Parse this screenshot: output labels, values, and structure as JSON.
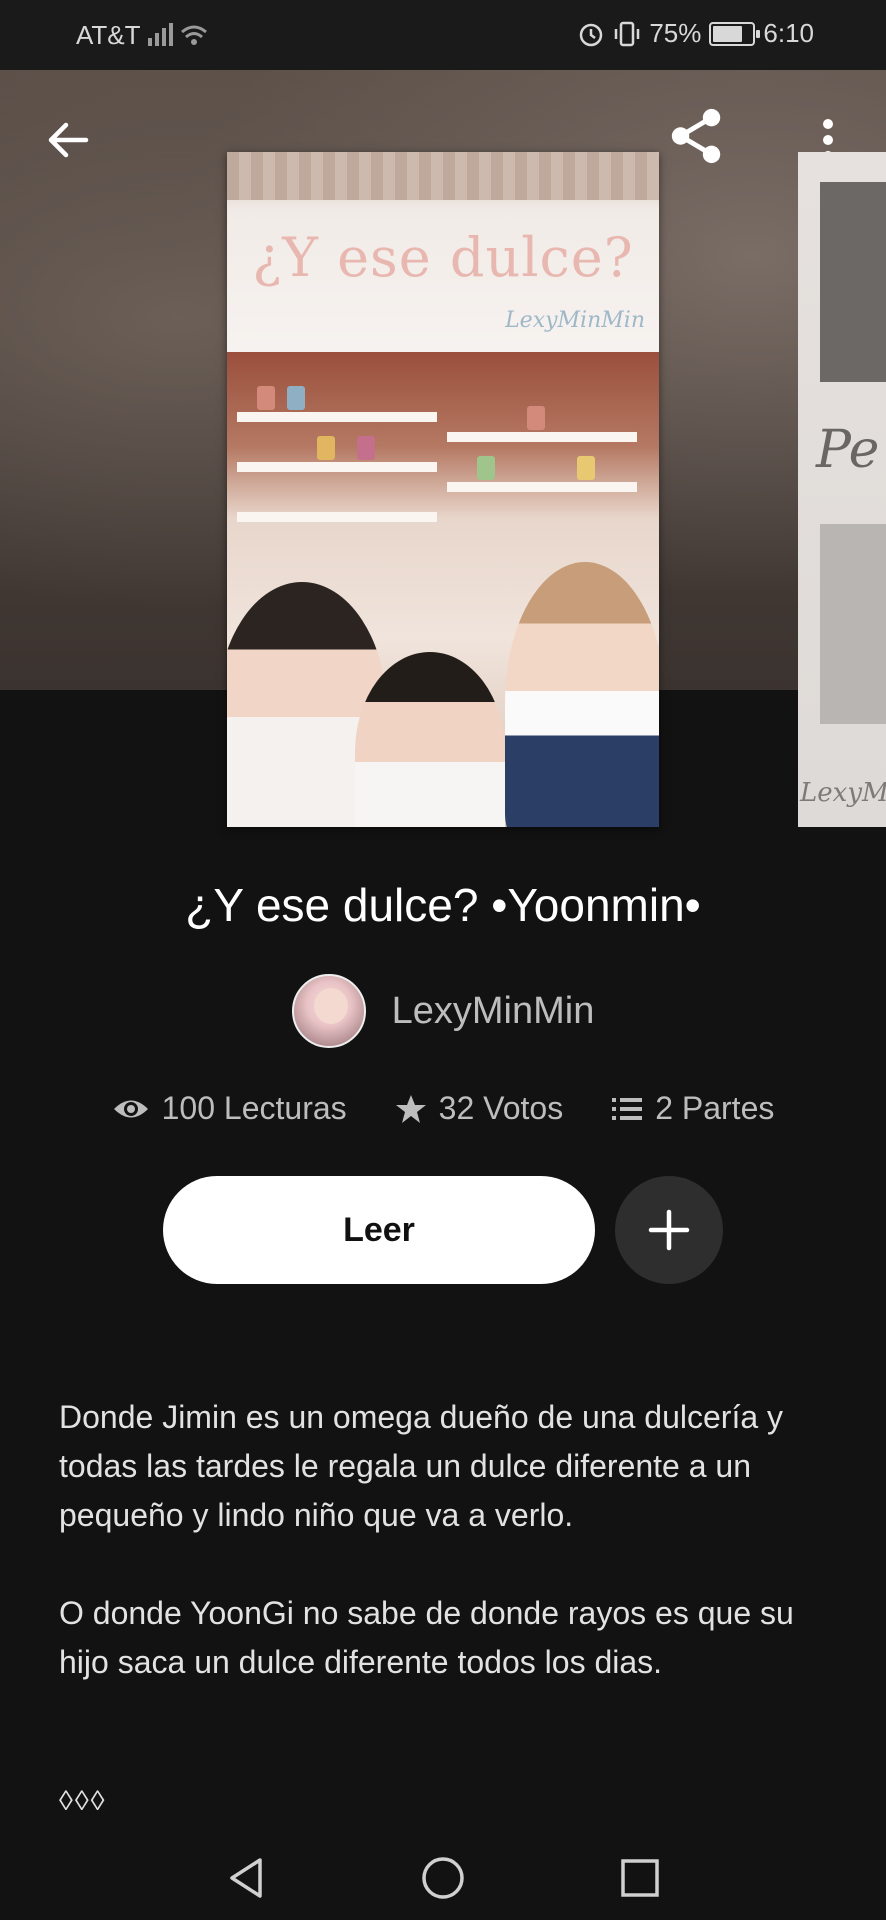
{
  "status_bar": {
    "carrier": "AT&T",
    "battery": "75%",
    "battery_fraction": 0.75,
    "time": "6:10"
  },
  "header": {
    "back_icon": "arrow-left-icon",
    "share_icon": "share-icon",
    "menu_icon": "more-vertical-icon"
  },
  "cover": {
    "title": "¿Y ese dulce?",
    "author": "LexyMinMin",
    "side_text": "Pe",
    "side_signature": "LexyM"
  },
  "story": {
    "title": "¿Y ese dulce? •Yoonmin•",
    "author": "LexyMinMin"
  },
  "stats": {
    "reads": "100 Lecturas",
    "votes": "32 Votos",
    "parts": "2 Partes"
  },
  "actions": {
    "read_label": "Leer"
  },
  "description": {
    "paragraph1": "Donde Jimin es un omega dueño de una dulcería y todas las tardes le regala un dulce diferente a un pequeño y lindo niño que va a verlo.",
    "paragraph2": "O donde YoonGi no sabe de donde rayos es que su hijo saca un dulce diferente todos los dias.",
    "separator": "◊◊◊"
  },
  "nav": {
    "back_icon": "triangle-back-icon",
    "home_icon": "circle-home-icon",
    "recents_icon": "square-recents-icon"
  },
  "colors": {
    "background": "#121212",
    "button_primary": "#ffffff",
    "button_secondary": "#2e2e2e",
    "muted_text": "#bdbdbd"
  }
}
